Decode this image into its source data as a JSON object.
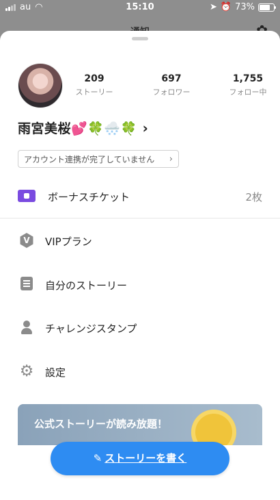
{
  "status_bar": {
    "carrier": "au",
    "time": "15:10",
    "battery": "73%"
  },
  "background": {
    "title": "通知"
  },
  "profile": {
    "name": "雨宮美桜💕🍀🌨️🍀",
    "stats": [
      {
        "value": "209",
        "label": "ストーリー"
      },
      {
        "value": "697",
        "label": "フォロワー"
      },
      {
        "value": "1,755",
        "label": "フォロー中"
      }
    ],
    "link_notice": "アカウント連携が完了していません"
  },
  "ticket": {
    "label": "ボーナスチケット",
    "count": "2枚"
  },
  "menu": [
    {
      "label": "VIPプラン",
      "icon": "vip-icon"
    },
    {
      "label": "自分のストーリー",
      "icon": "document-icon"
    },
    {
      "label": "チャレンジスタンプ",
      "icon": "user-icon"
    },
    {
      "label": "設定",
      "icon": "gear-icon"
    }
  ],
  "banner": {
    "text": "公式ストーリーが読み放題！"
  },
  "cta": {
    "label": "ストーリーを書く"
  },
  "colors": {
    "accent": "#2e8cf2",
    "ticket": "#7a4be0"
  }
}
